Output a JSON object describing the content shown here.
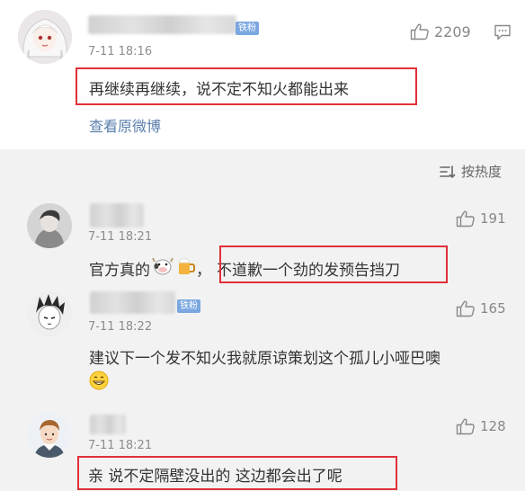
{
  "top_comment": {
    "badge": "铁粉",
    "time": "7-11 18:16",
    "text": "再继续再继续，说不定不知火都能出来",
    "likes": "2209",
    "view_original": "查看原微博"
  },
  "sort_label": "按热度",
  "comments": [
    {
      "time": "7-11 18:21",
      "text_before": "官方真的",
      "text_after": "，",
      "boxed_text": "不道歉一个劲的发预告挡刀",
      "likes": "191",
      "emoji": [
        "cow-face-icon",
        "beer-mug-icon"
      ]
    },
    {
      "badge": "铁粉",
      "time": "7-11 18:22",
      "text": "建议下一个发不知火我就原谅策划这个孤儿小哑巴噢",
      "likes": "165",
      "emoji": [
        "grinning-face-icon"
      ]
    },
    {
      "time": "7-11 18:21",
      "boxed_text": "亲 说不定隔壁没出的 这边都会出了呢",
      "likes": "128"
    }
  ],
  "colors": {
    "highlight_box": "#e0303a",
    "link": "#5b7fad",
    "badge": "#7aa7e0",
    "background": "#f2f2f2"
  }
}
